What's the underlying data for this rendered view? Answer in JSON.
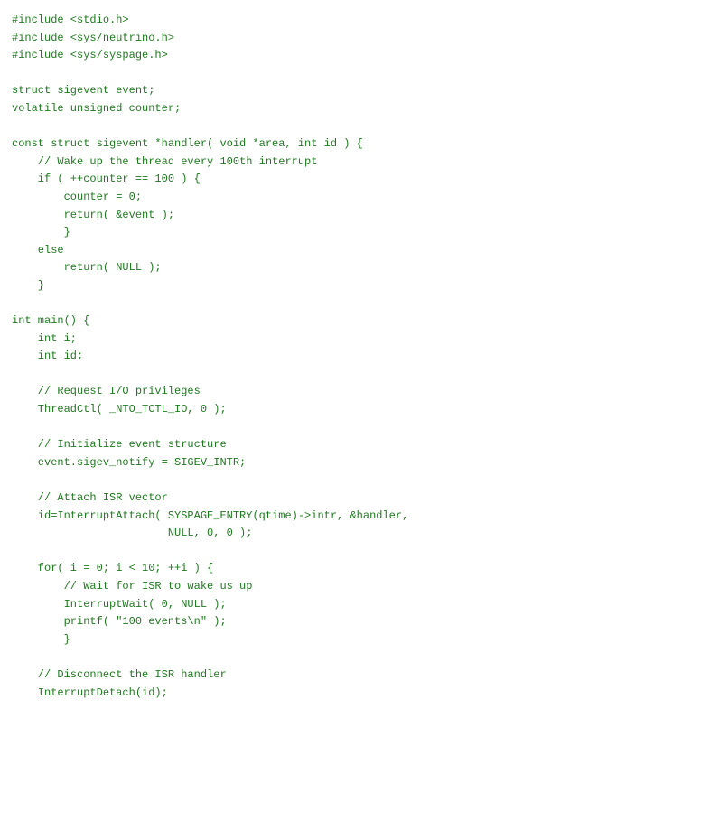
{
  "document": {
    "type": "code-listing",
    "language": "C",
    "text_color": "#1f7a1f",
    "background_color": "#ffffff",
    "lines": [
      "#include <stdio.h>",
      "#include <sys/neutrino.h>",
      "#include <sys/syspage.h>",
      "",
      "struct sigevent event;",
      "volatile unsigned counter;",
      "",
      "const struct sigevent *handler( void *area, int id ) {",
      "    // Wake up the thread every 100th interrupt",
      "    if ( ++counter == 100 ) {",
      "        counter = 0;",
      "        return( &event );",
      "        }",
      "    else",
      "        return( NULL );",
      "    }",
      "",
      "int main() {",
      "    int i;",
      "    int id;",
      "",
      "    // Request I/O privileges",
      "    ThreadCtl( _NTO_TCTL_IO, 0 );",
      "",
      "    // Initialize event structure",
      "    event.sigev_notify = SIGEV_INTR;",
      "",
      "    // Attach ISR vector",
      "    id=InterruptAttach( SYSPAGE_ENTRY(qtime)->intr, &handler,",
      "                        NULL, 0, 0 );",
      "",
      "    for( i = 0; i < 10; ++i ) {",
      "        // Wait for ISR to wake us up",
      "        InterruptWait( 0, NULL );",
      "        printf( \"100 events\\n\" );",
      "        }",
      "",
      "    // Disconnect the ISR handler",
      "    InterruptDetach(id);"
    ]
  }
}
